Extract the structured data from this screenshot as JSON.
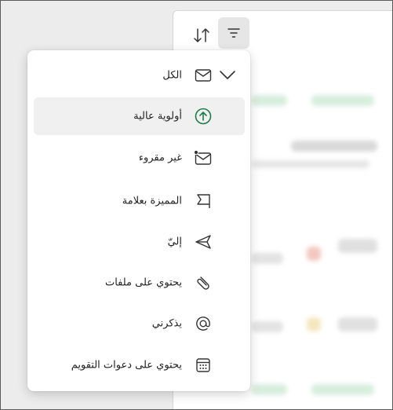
{
  "toolbar": {
    "sort_icon": "sort-arrows-icon",
    "filter_icon": "filter-lines-icon"
  },
  "filter_menu": {
    "items": [
      {
        "label": "الكل",
        "icon": "envelope-icon",
        "selected": true
      },
      {
        "label": "أولوية عالية",
        "icon": "arrow-up-circle-icon",
        "highlighted": true
      },
      {
        "label": "غير مقروء",
        "icon": "envelope-unread-icon"
      },
      {
        "label": "المميزة بعلامة",
        "icon": "flag-icon"
      },
      {
        "label": "إليّ",
        "icon": "send-icon"
      },
      {
        "label": "يحتوي على ملفات",
        "icon": "paperclip-icon"
      },
      {
        "label": "يذكرني",
        "icon": "mention-icon"
      },
      {
        "label": "يحتوي على دعوات التقويم",
        "icon": "calendar-icon"
      }
    ]
  },
  "colors": {
    "accent_green": "#1e7a46",
    "menu_bg": "#ffffff",
    "highlight_bg": "#f0f0f0"
  }
}
